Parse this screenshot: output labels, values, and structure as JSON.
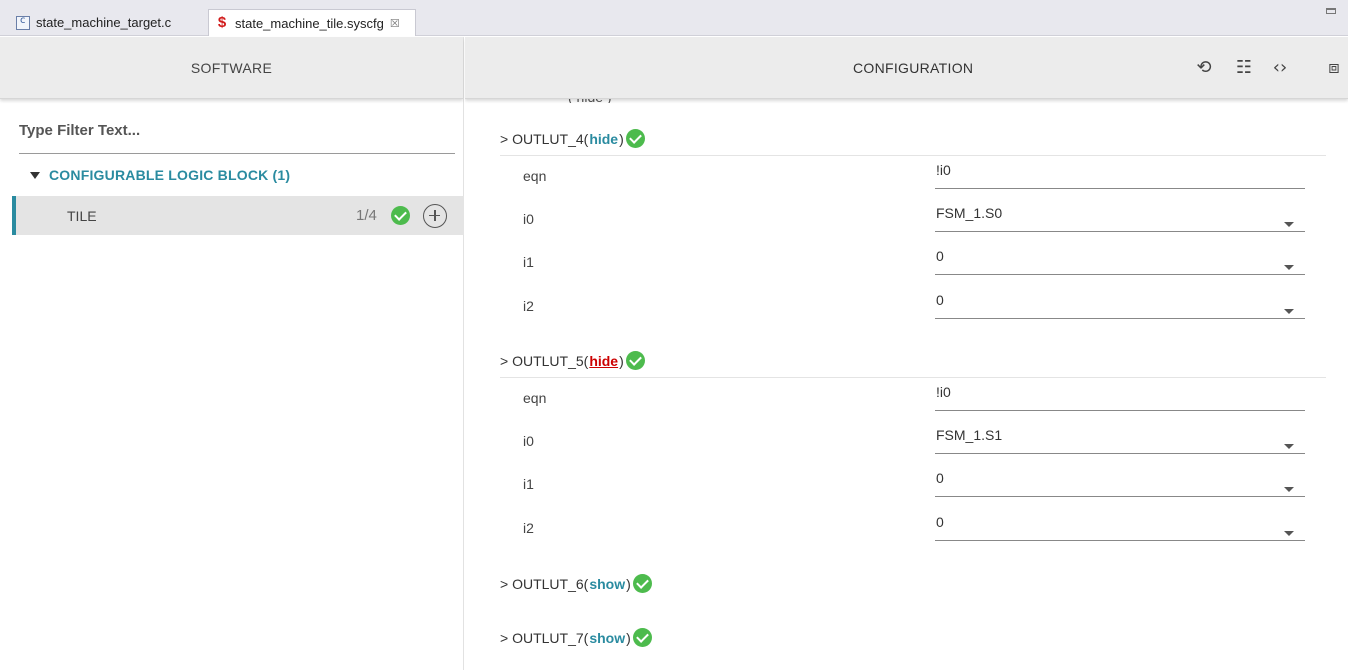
{
  "tabs": [
    {
      "label": "state_machine_target.c",
      "icon": "c-file-icon"
    },
    {
      "label": "state_machine_tile.syscfg",
      "icon": "syscfg-icon",
      "close": "☒"
    }
  ],
  "left": {
    "header": "SOFTWARE",
    "filter_placeholder": "Type Filter Text...",
    "category": "CONFIGURABLE LOGIC BLOCK (1)",
    "tile": {
      "label": "TILE",
      "count": "1/4"
    }
  },
  "right": {
    "header": "CONFIGURATION",
    "icons": [
      "history-icon",
      "settings-sliders-icon",
      "code-icon",
      "chip-icon"
    ],
    "sections": [
      {
        "name": "> OUTLUT_4",
        "toggle": "hide",
        "props": [
          {
            "label": "eqn",
            "value": "!i0",
            "dropdown": false
          },
          {
            "label": "i0",
            "value": "FSM_1.S0",
            "dropdown": true
          },
          {
            "label": "i1",
            "value": "0",
            "dropdown": true
          },
          {
            "label": "i2",
            "value": "0",
            "dropdown": true
          }
        ]
      },
      {
        "name": "> OUTLUT_5",
        "toggle": "hide",
        "props": [
          {
            "label": "eqn",
            "value": "!i0",
            "dropdown": false
          },
          {
            "label": "i0",
            "value": "FSM_1.S1",
            "dropdown": true
          },
          {
            "label": "i1",
            "value": "0",
            "dropdown": true
          },
          {
            "label": "i2",
            "value": "0",
            "dropdown": true
          }
        ]
      },
      {
        "name": "> OUTLUT_6",
        "toggle": "show",
        "props": []
      },
      {
        "name": "> OUTLUT_7",
        "toggle": "show",
        "props": []
      }
    ]
  },
  "colors": {
    "accent": "#2a8ba0",
    "ok": "#4dbb4d",
    "active_link": "#cc0000"
  }
}
